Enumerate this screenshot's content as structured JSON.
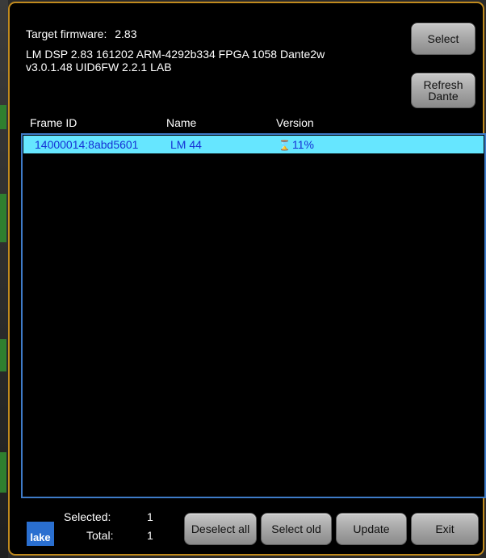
{
  "header": {
    "target_firmware_label": "Target firmware:",
    "target_firmware_value": "2.83",
    "firmware_line1": "LM DSP 2.83 161202 ARM-4292b334 FPGA 1058 Dante2w",
    "firmware_line2": "v3.0.1.48 UID6FW 2.2.1  LAB"
  },
  "buttons": {
    "select": "Select",
    "refresh_line1": "Refresh",
    "refresh_line2": "Dante",
    "deselect_all": "Deselect all",
    "select_old": "Select old",
    "update": "Update",
    "exit": "Exit"
  },
  "table": {
    "columns": [
      "Frame ID",
      "Name",
      "Version"
    ],
    "rows": [
      {
        "frame_id": "14000014:8abd5601",
        "name": "LM 44",
        "version": "11%",
        "selected": true
      }
    ]
  },
  "footer": {
    "selected_label": "Selected:",
    "selected_count": "1",
    "total_label": "Total:",
    "total_count": "1",
    "logo_text": "lake"
  },
  "colors": {
    "selected_row_bg": "#66e6ff",
    "selected_row_text": "#1631d6",
    "window_border": "#c08a1e",
    "list_border": "#3e7bc8"
  },
  "icons": {
    "progress": "hourglass-icon"
  }
}
